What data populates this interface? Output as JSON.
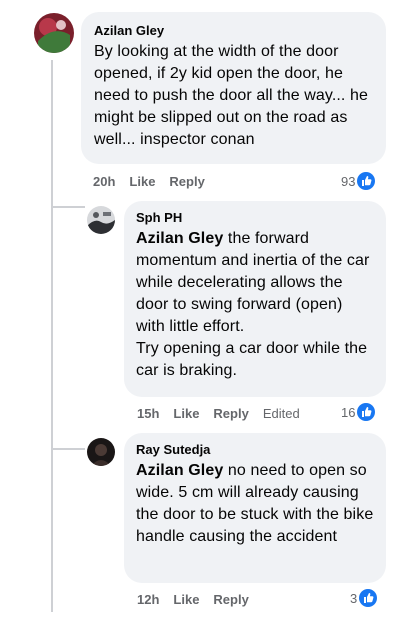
{
  "comments": [
    {
      "author": "Azilan Gley",
      "mention": "",
      "text": "By looking at the width of the door opened, if 2y kid open the door, he need to push the door all the way... he might be slipped out on the road as well... inspector conan",
      "time": "20h",
      "like_label": "Like",
      "reply_label": "Reply",
      "edited_label": "",
      "reaction_count": "93",
      "accent": "#1877f2"
    },
    {
      "author": "Sph PH",
      "mention": "Azilan Gley",
      "text": " the forward momentum and inertia of the car while decelerating allows the door to swing forward (open) with little effort.",
      "text_2": "Try opening a car door while the car is braking.",
      "time": "15h",
      "like_label": "Like",
      "reply_label": "Reply",
      "edited_label": "Edited",
      "reaction_count": "16",
      "accent": "#1877f2"
    },
    {
      "author": "Ray Sutedja",
      "mention": "Azilan Gley",
      "text": " no need to open so wide. 5 cm will already causing the door to be stuck with the bike handle causing the accident",
      "time": "12h",
      "like_label": "Like",
      "reply_label": "Reply",
      "edited_label": "",
      "reaction_count": "3",
      "accent": "#1877f2"
    }
  ]
}
